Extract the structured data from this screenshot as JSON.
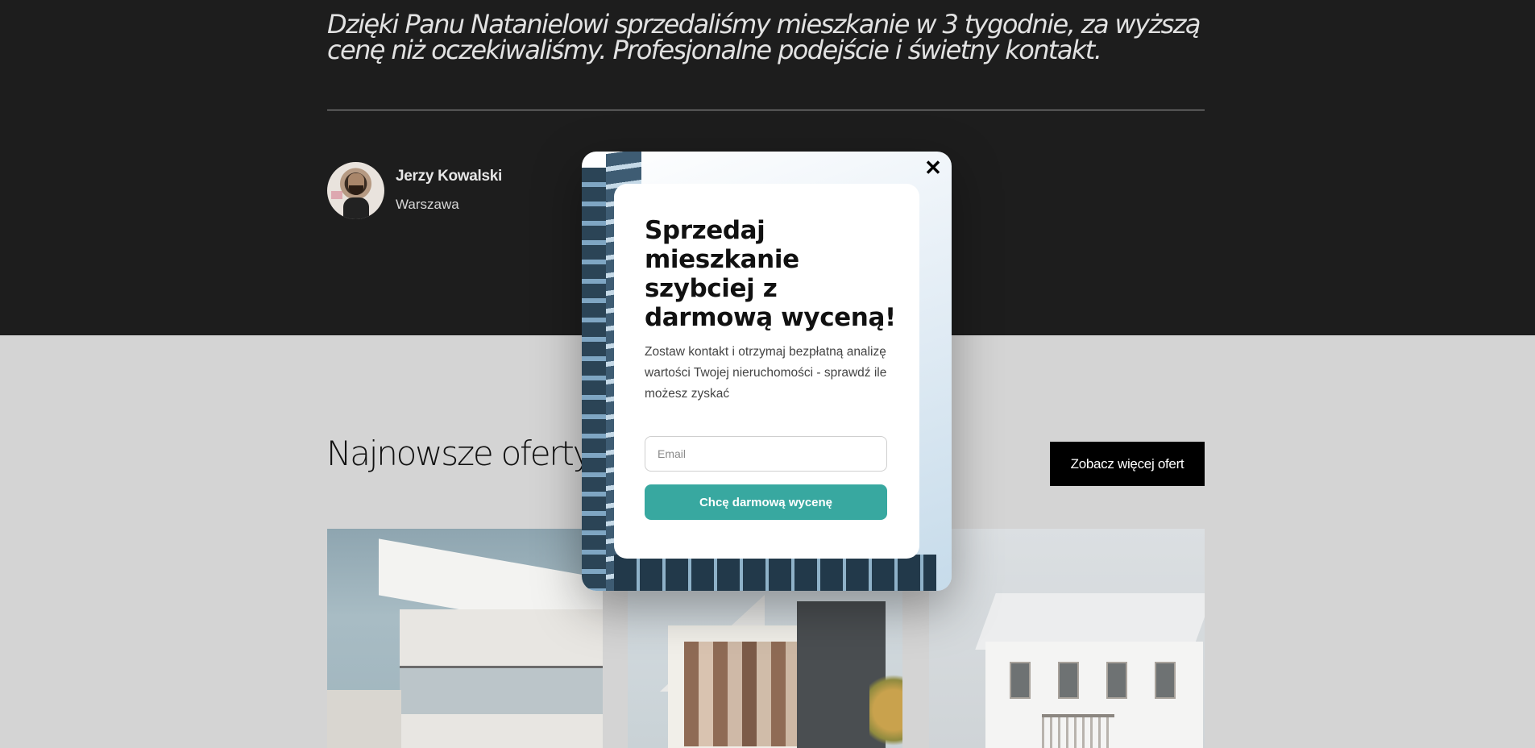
{
  "testimonial": {
    "quote": "Dzięki Panu Natanielowi sprzedaliśmy mieszkanie w 3 tygodnie, za wyższą cenę niż oczekiwaliśmy. Profesjonalne podejście i świetny kontakt.",
    "author_name": "Jerzy Kowalski",
    "author_city": "Warszawa"
  },
  "offers": {
    "title": "Najnowsze oferty",
    "more_button": "Zobacz więcej ofert"
  },
  "popup": {
    "title": "Sprzedaj mieszkanie szybciej z darmową wyceną!",
    "description": "Zostaw kontakt i otrzymaj bezpłatną analizę wartości Twojej nieruchomości - sprawdź ile możesz zyskać",
    "email_placeholder": "Email",
    "submit_label": "Chcę darmową wycenę",
    "close_label": "✕"
  },
  "colors": {
    "dark_bg": "#1d1d1d",
    "accent": "#38a8a0"
  }
}
